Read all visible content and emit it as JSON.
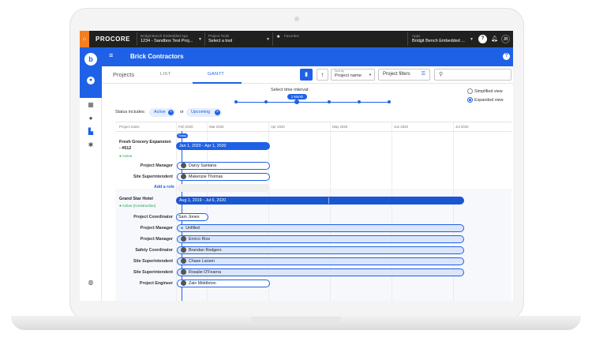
{
  "topbar": {
    "brand": "PROCORE",
    "app_sub": "Bridgit Bench Embedded App",
    "app_value": "1234 - Sandbox Test Proj...",
    "tools_sub": "Project Tools",
    "tools_value": "Select a tool",
    "favorites": "Favorites",
    "apps_sub": "Apps",
    "apps_value": "Bridgit Bench Embedded ...",
    "initials": "JB"
  },
  "header": {
    "title": "Brick Contractors"
  },
  "subbar": {
    "projects": "Projects",
    "tab_list": "LIST",
    "tab_gantt": "GANTT",
    "sort_by_label": "Sort by",
    "sort_by_value": "Project name",
    "filters": "Project filters"
  },
  "timeline": {
    "label": "Select time interval:",
    "selected": "1 Month",
    "view_simplified": "Simplified view",
    "view_expanded": "Expanded view"
  },
  "status": {
    "label": "Status includes:",
    "chip_active": "Active",
    "or": "or",
    "chip_upcoming": "Upcoming"
  },
  "grid": {
    "col_project": "Project name",
    "months": [
      "Feb 2020",
      "Mar 2020",
      "Apr 2020",
      "May 2020",
      "Jun 2020",
      "Jul 2020"
    ],
    "today": "Today"
  },
  "projects": [
    {
      "title_line1": "Fresh Grocery Expansion",
      "title_line2": "- #512",
      "status": "● Active",
      "range": "Jan 1, 2020 - Apr 1, 2020",
      "roles": [
        {
          "role": "Project Manager",
          "person": "Darcy Santana"
        },
        {
          "role": "Site Superintendent",
          "person": "Makenzie Thomas"
        }
      ],
      "add_role": "Add a role"
    },
    {
      "title": "Grand Star Hotel",
      "status": "● Active (Construction)",
      "range": "Aug 1, 2019 - Jul 6, 2020",
      "roles": [
        {
          "role": "Project Coordinator",
          "person": "Sam Jones"
        },
        {
          "role": "Project Manager",
          "person": "Unfilled"
        },
        {
          "role": "Project Manager",
          "person": "Enrico Rios"
        },
        {
          "role": "Safety Coordinator",
          "person": "Brandan Rodgers"
        },
        {
          "role": "Site Superintendent",
          "person": "Chase Larsen"
        },
        {
          "role": "Site Superintendent",
          "person": "Rosalie O'Fearna"
        },
        {
          "role": "Project Engineer",
          "person": "Zain Middleton"
        }
      ]
    }
  ],
  "colors": {
    "primary": "#1e61e6",
    "topbar": "#202020",
    "home": "#f47e20"
  }
}
